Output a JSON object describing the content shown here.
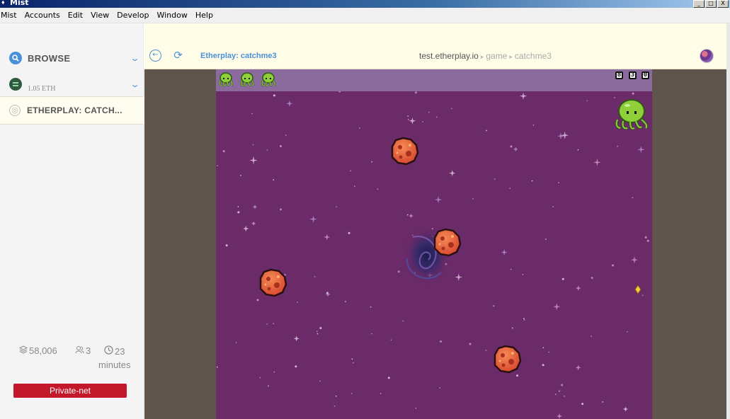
{
  "window": {
    "title": "Mist",
    "controls": [
      "_",
      "□",
      "X"
    ]
  },
  "menu": [
    "Mist",
    "Accounts",
    "Edit",
    "View",
    "Develop",
    "Window",
    "Help"
  ],
  "sidebar": {
    "browse_label": "BROWSE",
    "account_balance": "1.05 ETH",
    "tab_label": "ETHERPLAY: CATCH...",
    "stats": {
      "blocks": "58,006",
      "peers": "3",
      "time": "23",
      "time_unit": "minutes"
    },
    "network": "Private-net"
  },
  "header": {
    "page_title": "Etherplay: catchme3",
    "url_host": "test.etherplay.io",
    "url_segments": [
      "game",
      "catchme3"
    ]
  },
  "game": {
    "lives": 3,
    "score_digits": [
      "8",
      "3",
      "0"
    ],
    "colors": {
      "space": "#6b2a68",
      "hud": "#8b6a9e",
      "asteroid": "#e0553a",
      "octopus": "#8fcf3a"
    }
  },
  "colors": {
    "accent": "#4a90d9",
    "network_badge": "#c3172b"
  }
}
